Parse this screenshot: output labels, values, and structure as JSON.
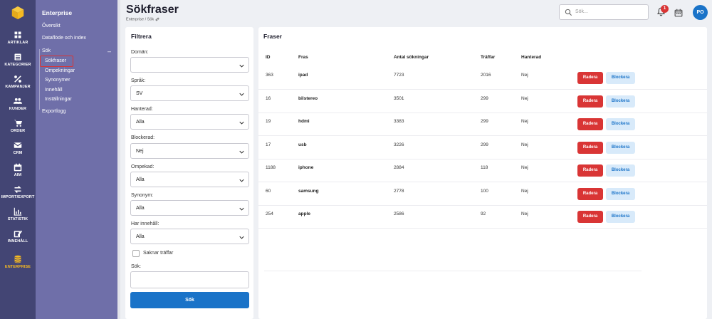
{
  "app": {
    "colors": {
      "rail": "#434574",
      "subnav": "#6f6fa9",
      "accent": "#1a73c8",
      "danger": "#d93535",
      "active": "#f5b921"
    }
  },
  "rail": {
    "items": [
      {
        "label": "ARTIKLAR",
        "icon": "cube-icon"
      },
      {
        "label": "KATEGORIER",
        "icon": "list-icon"
      },
      {
        "label": "KAMPANJER",
        "icon": "percent-icon"
      },
      {
        "label": "KUNDER",
        "icon": "users-icon"
      },
      {
        "label": "ORDER",
        "icon": "cart-icon"
      },
      {
        "label": "CRM",
        "icon": "mail-icon"
      },
      {
        "label": "AIM",
        "icon": "calendar-icon"
      },
      {
        "label": "IMPORT/EXPORT",
        "icon": "arrows-icon"
      },
      {
        "label": "STATISTIK",
        "icon": "chart-icon"
      },
      {
        "label": "INNEHÅLL",
        "icon": "edit-icon"
      },
      {
        "label": "ENTERPRISE",
        "icon": "database-icon"
      }
    ]
  },
  "subnav": {
    "title": "Enterprise",
    "items": [
      "Översikt",
      "Dataflöde och index",
      "Sök",
      "Exportlogg"
    ],
    "sok_toggle": "–",
    "sok_children": [
      "Sökfraser",
      "Ompekningar",
      "Synonymer",
      "Innehåll",
      "Inställningar"
    ]
  },
  "header": {
    "title": "Sökfraser",
    "breadcrumb": "Enterprise / Sök",
    "search_placeholder": "Sök...",
    "notifications": "1",
    "avatar": "PO"
  },
  "filter": {
    "title": "Filtrera",
    "fields": [
      {
        "label": "Domän:",
        "value": ""
      },
      {
        "label": "Språk:",
        "value": "SV"
      },
      {
        "label": "Hanterad:",
        "value": "Alla"
      },
      {
        "label": "Blockerad:",
        "value": "Nej"
      },
      {
        "label": "Ompekad:",
        "value": "Alla"
      },
      {
        "label": "Synonym:",
        "value": "Alla"
      },
      {
        "label": "Har innehåll:",
        "value": "Alla"
      }
    ],
    "checkbox_label": "Saknar träffar",
    "search_label": "Sök:",
    "button": "Sök"
  },
  "table": {
    "title": "Fraser",
    "headers": [
      "ID",
      "Fras",
      "Antal sökningar",
      "Träffar",
      "Hanterad"
    ],
    "delete_label": "Radera",
    "block_label": "Blockera",
    "rows": [
      [
        "363",
        "ipad",
        "7723",
        "2016",
        "Nej"
      ],
      [
        "16",
        "bilstereo",
        "3501",
        "299",
        "Nej"
      ],
      [
        "19",
        "hdmi",
        "3383",
        "299",
        "Nej"
      ],
      [
        "17",
        "usb",
        "3226",
        "299",
        "Nej"
      ],
      [
        "1188",
        "iphone",
        "2884",
        "118",
        "Nej"
      ],
      [
        "60",
        "samsung",
        "2778",
        "100",
        "Nej"
      ],
      [
        "254",
        "apple",
        "2586",
        "92",
        "Nej"
      ]
    ]
  }
}
